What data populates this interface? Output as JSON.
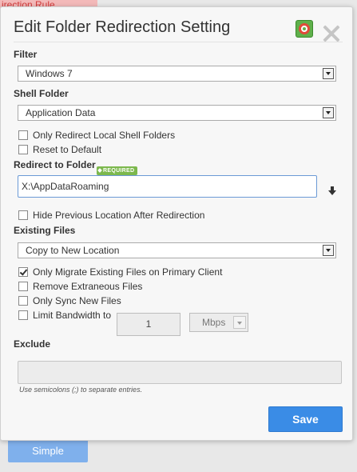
{
  "background": {
    "tab_label": "irection Rule",
    "simple_button": "Simple"
  },
  "dialog": {
    "title": "Edit Folder Redirection Setting"
  },
  "filter": {
    "label": "Filter",
    "value": "Windows 7"
  },
  "shell_folder": {
    "label": "Shell Folder",
    "value": "Application Data"
  },
  "options": {
    "only_redirect_local": {
      "label": "Only Redirect Local Shell Folders",
      "checked": false
    },
    "reset_to_default": {
      "label": "Reset to Default",
      "checked": false
    }
  },
  "redirect": {
    "label": "Redirect to Folder",
    "badge": "REQUIRED",
    "value": "X:\\AppDataRoaming"
  },
  "hide_previous": {
    "label": "Hide Previous Location After Redirection",
    "checked": false
  },
  "existing_files": {
    "label": "Existing Files",
    "value": "Copy to New Location"
  },
  "migrate_options": {
    "only_migrate": {
      "label": "Only Migrate Existing Files on Primary Client",
      "checked": true
    },
    "remove_extraneous": {
      "label": "Remove Extraneous Files",
      "checked": false
    },
    "only_sync_new": {
      "label": "Only Sync New Files",
      "checked": false
    },
    "limit_bandwidth": {
      "label": "Limit Bandwidth to",
      "checked": false
    }
  },
  "bandwidth": {
    "value": "1",
    "unit": "Mbps"
  },
  "exclude": {
    "label": "Exclude",
    "value": "",
    "hint": "Use semicolons (;) to separate entries."
  },
  "buttons": {
    "save": "Save"
  },
  "colors": {
    "accent": "#3a8ce6",
    "badge": "#7cb84d",
    "help_green": "#5fb04b"
  }
}
